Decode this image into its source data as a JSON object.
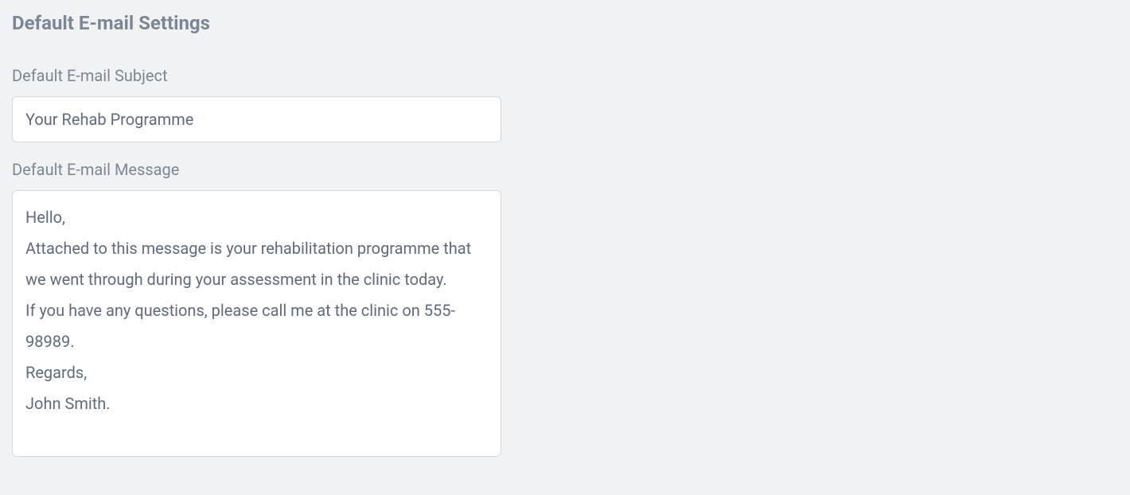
{
  "section": {
    "title": "Default E-mail Settings"
  },
  "fields": {
    "subject": {
      "label": "Default E-mail Subject",
      "value": "Your Rehab Programme"
    },
    "message": {
      "label": "Default E-mail Message",
      "value": "Hello,\nAttached to this message is your rehabilitation programme that we went through during your assessment in the clinic today.\nIf you have any questions, please call me at the clinic on 555-98989.\nRegards,\nJohn Smith."
    }
  }
}
